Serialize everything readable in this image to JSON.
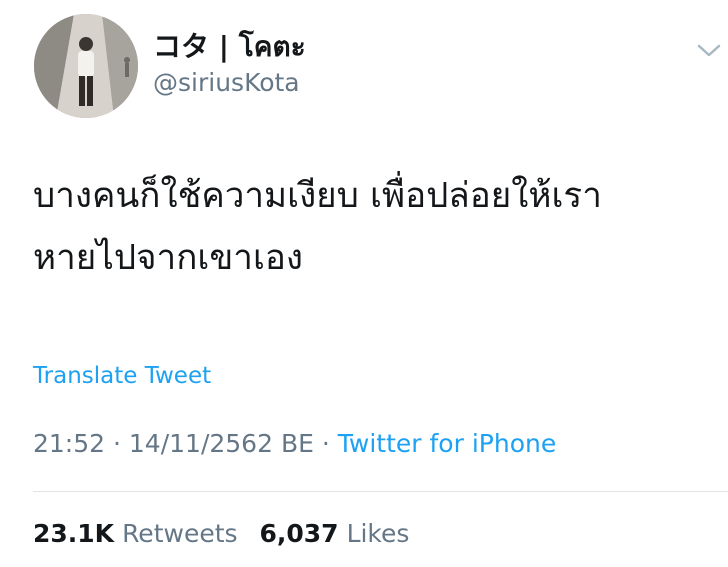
{
  "author": {
    "display_name": "コタ | โคตะ",
    "handle": "@siriusKota"
  },
  "tweet": {
    "lines": [
      "บางคนก็ใช้ความเงียบ เพื่อปล่อยให้เรา",
      "หายไปจากเขาเอง"
    ],
    "translate_label": "Translate Tweet",
    "time": "21:52",
    "separator": "·",
    "date": "14/11/2562 BE",
    "source": "Twitter for iPhone"
  },
  "stats": {
    "retweets_count": "23.1K",
    "retweets_label": "Retweets",
    "likes_count": "6,037",
    "likes_label": "Likes"
  },
  "icons": {
    "menu": "chevron-down-icon",
    "avatar": "avatar"
  },
  "colors": {
    "link": "#1da1f2",
    "secondary_text": "#657786",
    "primary_text": "#14171a",
    "divider": "#dfe4e8"
  }
}
